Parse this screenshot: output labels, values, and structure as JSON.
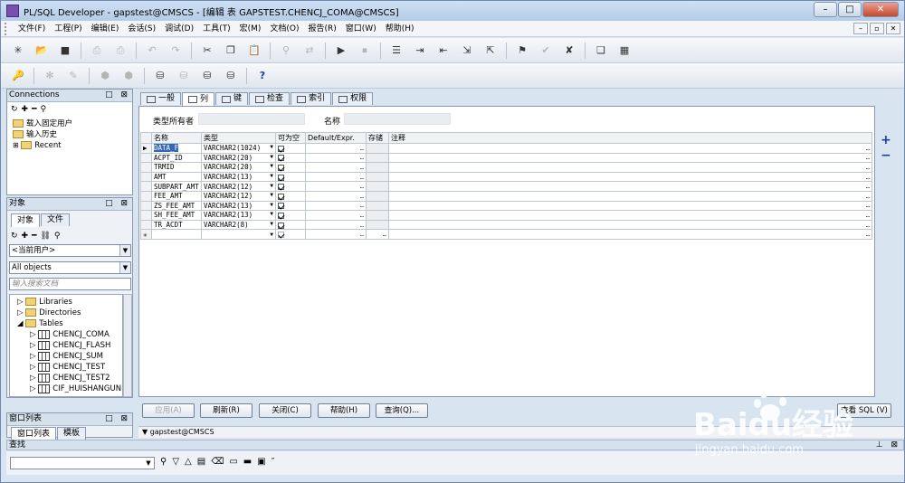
{
  "window": {
    "title": "PL/SQL Developer - gapstest@CMSCS - [编辑 表 GAPSTEST.CHENCJ_COMA@CMSCS]"
  },
  "menu": [
    "文件(F)",
    "工程(P)",
    "编辑(E)",
    "会话(S)",
    "调试(D)",
    "工具(T)",
    "宏(M)",
    "文档(O)",
    "报告(R)",
    "窗口(W)",
    "帮助(H)"
  ],
  "connections": {
    "title": "Connections",
    "items": [
      "载入固定用户",
      "输入历史",
      "Recent"
    ]
  },
  "objects": {
    "title": "对象",
    "tabs": [
      "对象",
      "文件"
    ],
    "user_combo": "<当前用户>",
    "filter_combo": "All objects",
    "search_placeholder": "输入搜索文档",
    "tree": [
      {
        "label": "Libraries",
        "kind": "folder"
      },
      {
        "label": "Directories",
        "kind": "folder"
      },
      {
        "label": "Tables",
        "kind": "folder"
      },
      {
        "label": "CHENCJ_COMA",
        "kind": "table"
      },
      {
        "label": "CHENCJ_FLASH",
        "kind": "table"
      },
      {
        "label": "CHENCJ_SUM",
        "kind": "table"
      },
      {
        "label": "CHENCJ_TEST",
        "kind": "table"
      },
      {
        "label": "CHENCJ_TEST2",
        "kind": "table"
      },
      {
        "label": "CIF_HUISHANGUNIN",
        "kind": "table"
      }
    ]
  },
  "winlist": {
    "title": "窗口列表",
    "tabs": [
      "窗口列表",
      "模板"
    ]
  },
  "find": {
    "title": "查找"
  },
  "editor": {
    "tabs": [
      "一般",
      "列",
      "键",
      "检查",
      "索引",
      "权限"
    ],
    "active_tab": "列",
    "owner_label": "类型所有者",
    "name_label": "名称",
    "columns": [
      "名称",
      "类型",
      "可为空",
      "Default/Expr.",
      "存储",
      "注释"
    ],
    "rows": [
      [
        "DATA_F",
        "VARCHAR2(1024)",
        true
      ],
      [
        "ACPT_ID",
        "VARCHAR2(20)",
        true
      ],
      [
        "TRMID",
        "VARCHAR2(20)",
        true
      ],
      [
        "AMT",
        "VARCHAR2(13)",
        true
      ],
      [
        "SUBPART_AMT",
        "VARCHAR2(12)",
        true
      ],
      [
        "FEE_AMT",
        "VARCHAR2(12)",
        true
      ],
      [
        "ZS_FEE_AMT",
        "VARCHAR2(13)",
        true
      ],
      [
        "SH_FEE_AMT",
        "VARCHAR2(13)",
        true
      ],
      [
        "TR_ACDT",
        "VARCHAR2(8)",
        true
      ]
    ]
  },
  "buttons": {
    "apply": "应用(A)",
    "refresh": "刷新(R)",
    "close": "关闭(C)",
    "help": "帮助(H)",
    "query": "查询(Q)...",
    "view_sql": "查看 SQL (V)"
  },
  "status": {
    "connection": "gapstest@CMSCS"
  },
  "watermark": {
    "brand": "Baidu经验",
    "url": "jingyan.baidu.com"
  }
}
